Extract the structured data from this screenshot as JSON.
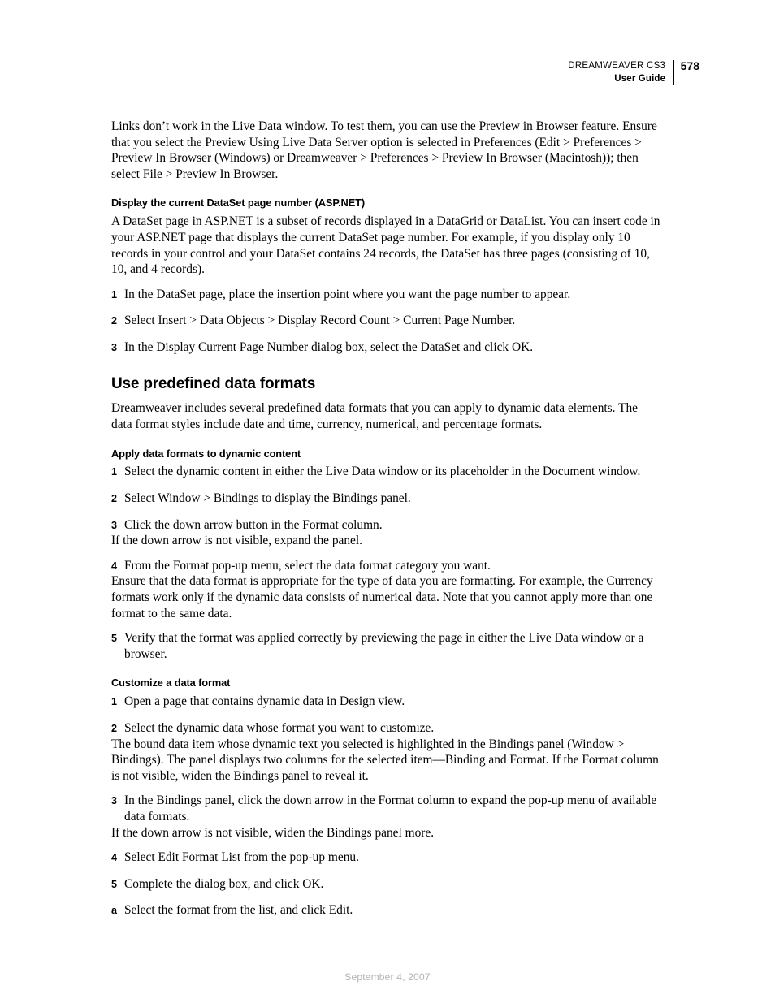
{
  "header": {
    "product": "DREAMWEAVER CS3",
    "guide": "User Guide",
    "page_number": "578"
  },
  "footer": {
    "date": "September 4, 2007"
  },
  "content": {
    "intro_paragraph": "Links don’t work in the Live Data window. To test them, you can use the Preview in Browser feature. Ensure that you select the Preview Using Live Data Server option is selected in Preferences (Edit > Preferences > Preview In Browser (Windows) or Dreamweaver > Preferences > Preview In Browser (Macintosh)); then select File > Preview In Browser.",
    "dataset_section": {
      "heading": "Display the current DataSet page number (ASP.NET)",
      "paragraph": "A DataSet page in ASP.NET is a subset of records displayed in a DataGrid or DataList. You can insert code in your ASP.NET page that displays the current DataSet page number. For example, if you display only 10 records in your control and your DataSet contains 24 records, the DataSet has three pages (consisting of 10, 10, and 4 records).",
      "steps": [
        {
          "marker": "1",
          "text": "In the DataSet page, place the insertion point where you want the page number to appear."
        },
        {
          "marker": "2",
          "text": "Select Insert > Data Objects > Display Record Count > Current Page Number."
        },
        {
          "marker": "3",
          "text": "In the Display Current Page Number dialog box, select the DataSet and click OK."
        }
      ]
    },
    "predefined_section": {
      "heading": "Use predefined data formats",
      "paragraph": "Dreamweaver includes several predefined data formats that you can apply to dynamic data elements. The data format styles include date and time, currency, numerical, and percentage formats.",
      "apply_subsection": {
        "heading": "Apply data formats to dynamic content",
        "steps_a": [
          {
            "marker": "1",
            "text": "Select the dynamic content in either the Live Data window or its placeholder in the Document window."
          },
          {
            "marker": "2",
            "text": "Select Window > Bindings to display the Bindings panel."
          },
          {
            "marker": "3",
            "text": "Click the down arrow button in the Format column."
          }
        ],
        "note_1": "If the down arrow is not visible, expand the panel.",
        "steps_b": [
          {
            "marker": "4",
            "text": "From the Format pop-up menu, select the data format category you want."
          }
        ],
        "note_2": "Ensure that the data format is appropriate for the type of data you are formatting. For example, the Currency formats work only if the dynamic data consists of numerical data. Note that you cannot apply more than one format to the same data.",
        "steps_c": [
          {
            "marker": "5",
            "text": "Verify that the format was applied correctly by previewing the page in either the Live Data window or a browser."
          }
        ]
      },
      "customize_subsection": {
        "heading": "Customize a data format",
        "steps_a": [
          {
            "marker": "1",
            "text": "Open a page that contains dynamic data in Design view."
          },
          {
            "marker": "2",
            "text": "Select the dynamic data whose format you want to customize."
          }
        ],
        "note_1": "The bound data item whose dynamic text you selected is highlighted in the Bindings panel (Window > Bindings). The panel displays two columns for the selected item—Binding and Format. If the Format column is not visible, widen the Bindings panel to reveal it.",
        "steps_b": [
          {
            "marker": "3",
            "text": "In the Bindings panel, click the down arrow in the Format column to expand the pop-up menu of available data formats."
          }
        ],
        "note_2": "If the down arrow is not visible, widen the Bindings panel more.",
        "steps_c": [
          {
            "marker": "4",
            "text": "Select Edit Format List from the pop-up menu."
          },
          {
            "marker": "5",
            "text": "Complete the dialog box, and click OK."
          },
          {
            "marker": "a",
            "text": "Select the format from the list, and click Edit."
          }
        ]
      }
    }
  }
}
